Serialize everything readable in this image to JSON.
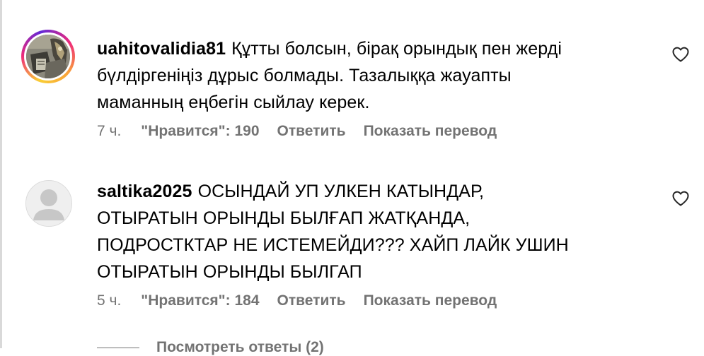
{
  "comments": [
    {
      "username": "uahitovalidia81",
      "lines": [
        "Құтты болсын, бірақ орындық пен жерді",
        "бүлдіргеніңіз дұрыс болмады. Тазалыққа жауапты",
        "маманның еңбегін сыйлау керек."
      ],
      "time": "7 ч.",
      "likes": "\"Нравится\": 190",
      "reply_label": "Ответить",
      "translate_label": "Показать перевод",
      "avatar": "story-ring-photo",
      "like_icon": "heart-outline-icon"
    },
    {
      "username": "saltika2025",
      "lines": [
        "ОСЫНДАЙ УП УЛКЕН КАТЫНДАР,",
        "ОТЫРАТЫН ОРЫНДЫ БЫЛҒАП ЖАТҚАНДА,",
        "ПОДРОСТКТАР НЕ ИСТЕМЕЙДИ??? ХАЙП ЛАЙК УШИН",
        "ОТЫРАТЫН ОРЫНДЫ БЫЛГАП"
      ],
      "time": "5 ч.",
      "likes": "\"Нравится\": 184",
      "reply_label": "Ответить",
      "translate_label": "Показать перевод",
      "avatar": "default-user-silhouette",
      "like_icon": "heart-outline-icon"
    }
  ],
  "view_replies_label": "Посмотреть ответы (2)",
  "colors": {
    "text": "#000000",
    "secondary": "#737373",
    "ring_start": "#f9ce34",
    "ring_mid": "#ee2a7b",
    "ring_end": "#6228d7"
  }
}
